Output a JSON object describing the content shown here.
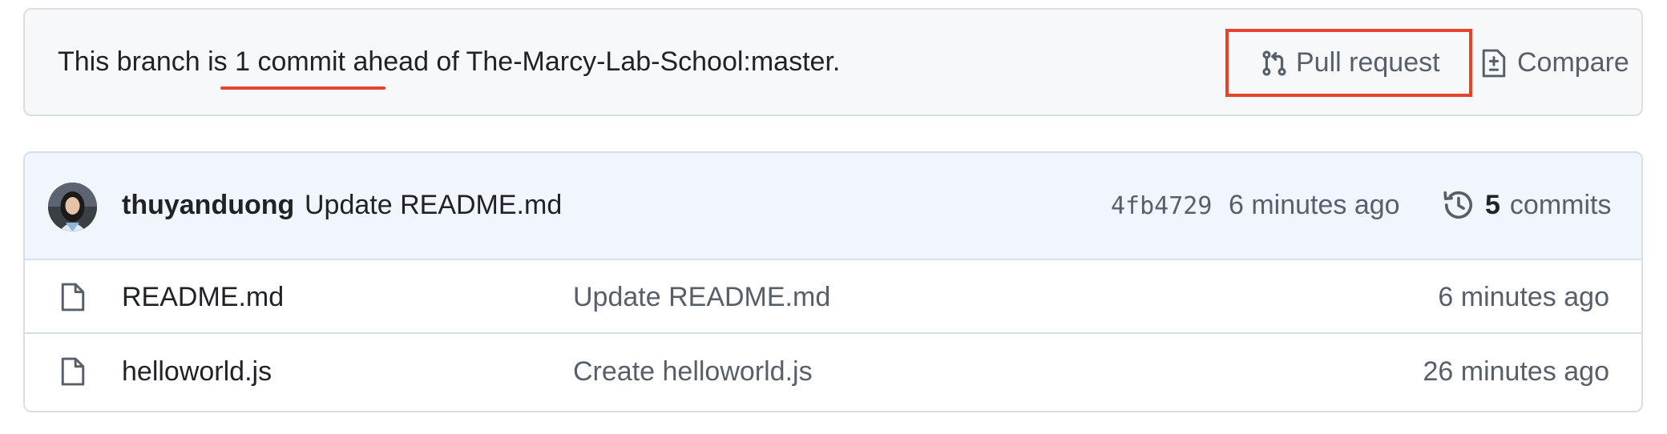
{
  "branch_status": {
    "text": "This branch is 1 commit ahead of The-Marcy-Lab-School:master.",
    "pull_request_label": "Pull request",
    "compare_label": "Compare"
  },
  "latest_commit": {
    "author": "thuyanduong",
    "message": "Update README.md",
    "sha": "4fb4729",
    "time": "6 minutes ago",
    "commits_count": "5",
    "commits_label": "commits"
  },
  "files": [
    {
      "icon": "file-icon",
      "name": "README.md",
      "commit_message": "Update README.md",
      "age": "6 minutes ago"
    },
    {
      "icon": "file-icon",
      "name": "helloworld.js",
      "commit_message": "Create helloworld.js",
      "age": "26 minutes ago"
    }
  ],
  "colors": {
    "annotation_red": "#e5432d",
    "bar_background": "#f6f8fa",
    "commit_header_background": "#f1f6fd",
    "border": "#d8dee4",
    "muted_text": "#57606a",
    "text": "#1f2328"
  }
}
